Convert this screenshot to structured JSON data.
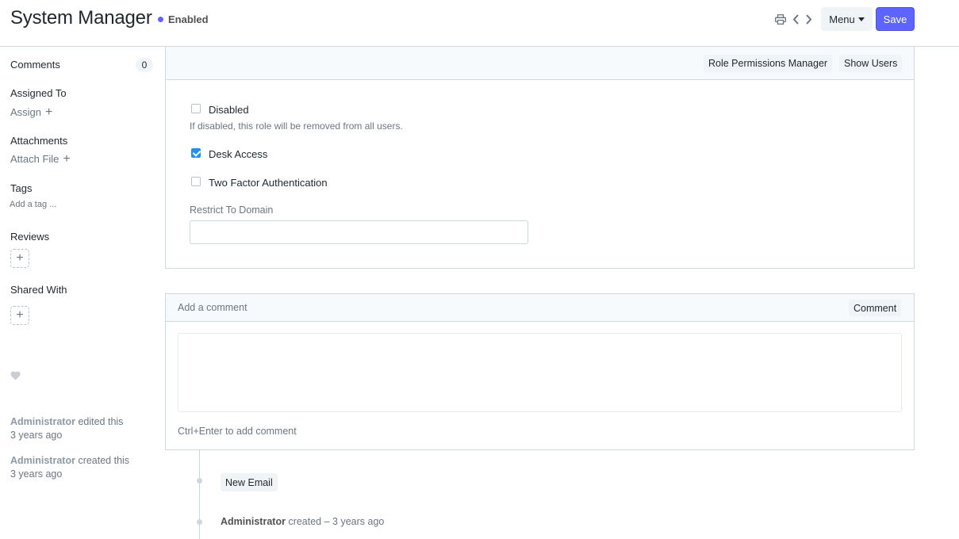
{
  "header": {
    "title": "System Manager",
    "status": "Enabled",
    "status_color": "#5e64ff",
    "menu_label": "Menu",
    "save_label": "Save"
  },
  "sidebar": {
    "comments_label": "Comments",
    "comments_count": "0",
    "assigned_to_label": "Assigned To",
    "assign_label": "Assign",
    "attachments_label": "Attachments",
    "attach_file_label": "Attach File",
    "tags_label": "Tags",
    "add_tag_label": "Add a tag ...",
    "reviews_label": "Reviews",
    "shared_with_label": "Shared With",
    "activity": [
      {
        "user": "Administrator",
        "action": "edited this",
        "time": "3 years ago"
      },
      {
        "user": "Administrator",
        "action": "created this",
        "time": "3 years ago"
      }
    ]
  },
  "form": {
    "toolbar": {
      "role_permissions_label": "Role Permissions Manager",
      "show_users_label": "Show Users"
    },
    "disabled": {
      "label": "Disabled",
      "checked": false,
      "help": "If disabled, this role will be removed from all users."
    },
    "desk_access": {
      "label": "Desk Access",
      "checked": true
    },
    "two_factor": {
      "label": "Two Factor Authentication",
      "checked": false
    },
    "restrict_to_domain": {
      "label": "Restrict To Domain",
      "value": ""
    }
  },
  "comment": {
    "placeholder": "Add a comment",
    "button_label": "Comment",
    "hint": "Ctrl+Enter to add comment"
  },
  "timeline": {
    "new_email_label": "New Email",
    "entry": {
      "user": "Administrator",
      "text": "created – 3 years ago"
    }
  }
}
